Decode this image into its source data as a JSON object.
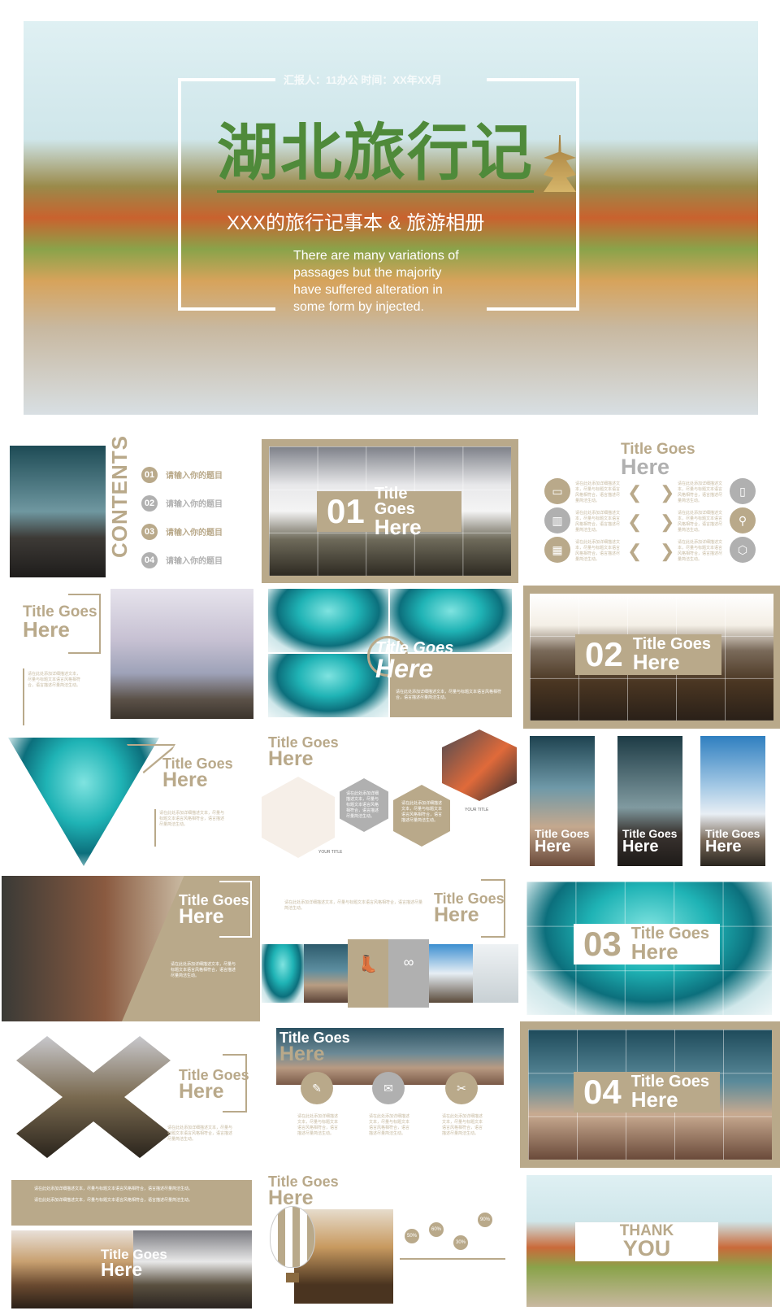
{
  "hero": {
    "reporter": "汇报人：11办公  时间：XX年XX月",
    "title": "湖北旅行记",
    "subtitle": "XXX的旅行记事本 & 旅游相册",
    "body": "There are many variations of passages but the majority have suffered alteration in some form by injected."
  },
  "common": {
    "title_goes": "Title Goes",
    "here": "Here",
    "desc": "请在此处添加详细描述文本，尽量与标题文本语言风格相符合，语言描述尽量简洁生动。",
    "your_title": "YOUR TITLE"
  },
  "contents": {
    "heading": "CONTENTS",
    "items": [
      {
        "num": "01",
        "label": "请输入你的题目"
      },
      {
        "num": "02",
        "label": "请输入你的题目"
      },
      {
        "num": "03",
        "label": "请输入你的题目"
      },
      {
        "num": "04",
        "label": "请输入你的题目"
      }
    ]
  },
  "sections": [
    {
      "num": "01"
    },
    {
      "num": "02"
    },
    {
      "num": "03"
    },
    {
      "num": "04"
    }
  ],
  "icons_slide": {
    "left_icons": [
      "monitor-icon",
      "chart-icon",
      "calendar-icon"
    ],
    "right_icons": [
      "phone-icon",
      "location-icon",
      "cube-icon"
    ]
  },
  "timeline": {
    "values": [
      "50%",
      "60%",
      "30%",
      "90%"
    ]
  },
  "thanks": {
    "line1": "THANK",
    "line2": "YOU"
  },
  "colors": {
    "accent": "#b9a98a",
    "gray": "#b0b0b0",
    "title_green": "#4f8a3a"
  }
}
